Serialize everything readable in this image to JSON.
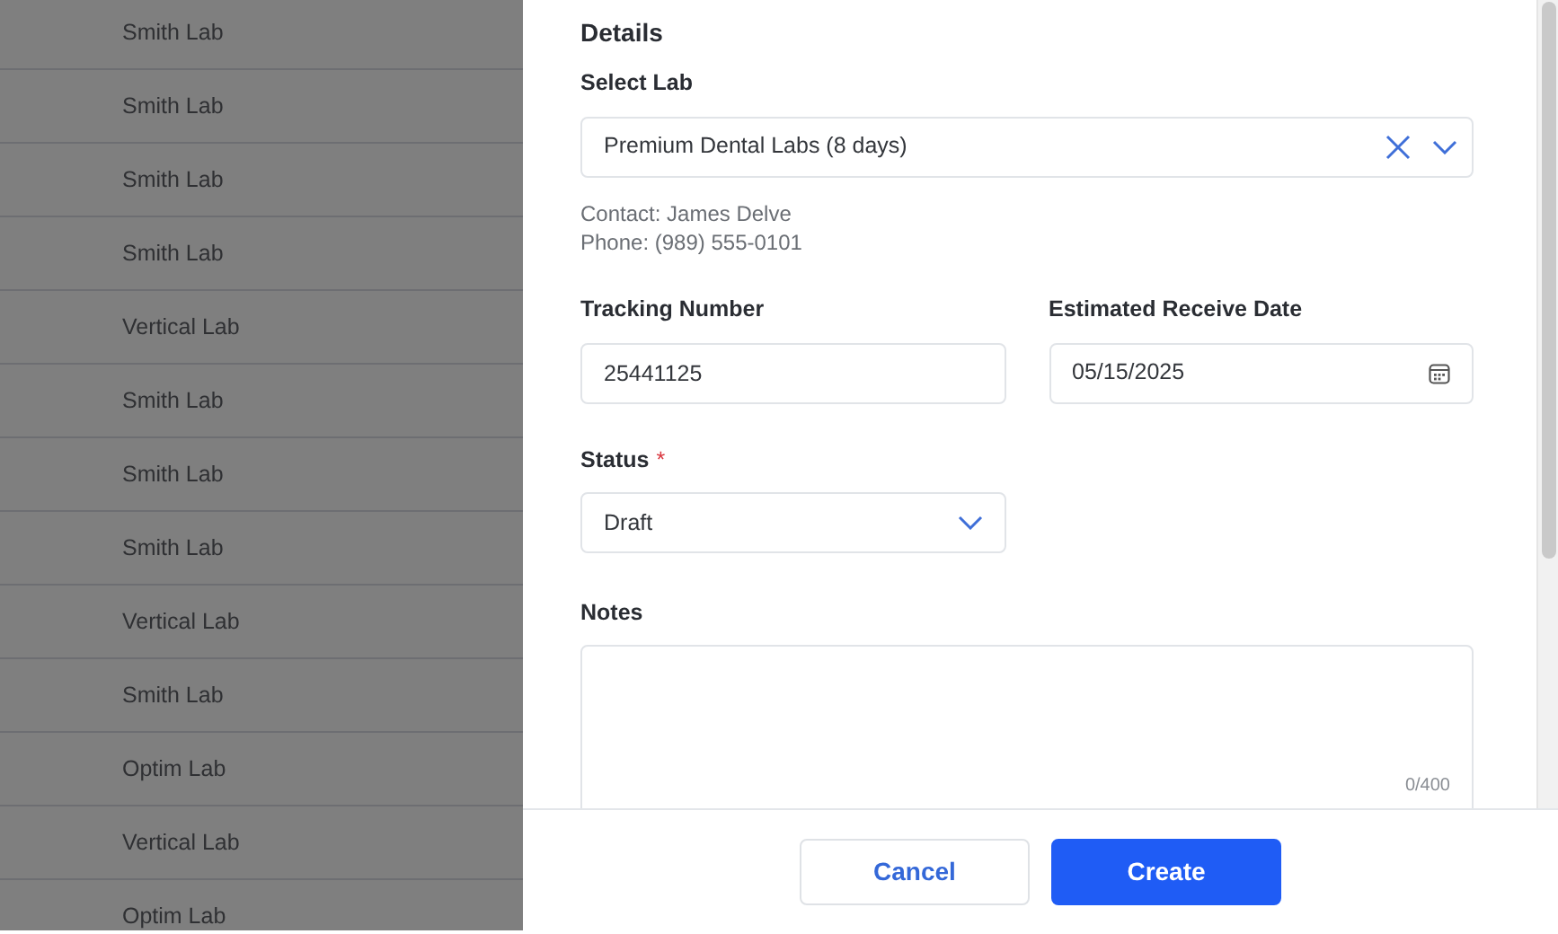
{
  "background_table": {
    "rows": [
      {
        "lab": "Smith Lab"
      },
      {
        "lab": "Smith Lab"
      },
      {
        "lab": "Smith Lab"
      },
      {
        "lab": "Smith Lab"
      },
      {
        "lab": "Vertical Lab"
      },
      {
        "lab": "Smith Lab"
      },
      {
        "lab": "Smith Lab"
      },
      {
        "lab": "Smith Lab"
      },
      {
        "lab": "Vertical Lab"
      },
      {
        "lab": "Smith Lab"
      },
      {
        "lab": "Optim Lab"
      },
      {
        "lab": "Vertical Lab"
      },
      {
        "lab": "Optim Lab"
      }
    ]
  },
  "panel": {
    "section_title": "Details",
    "select_lab": {
      "label": "Select Lab",
      "value": "Premium Dental Labs (8 days)"
    },
    "contact": "Contact: James Delve",
    "phone": "Phone: (989) 555-0101",
    "tracking_number": {
      "label": "Tracking Number",
      "value": "25441125"
    },
    "estimated_receive_date": {
      "label": "Estimated Receive Date",
      "value": "05/15/2025"
    },
    "status": {
      "label": "Status",
      "required_mark": "*",
      "value": "Draft"
    },
    "notes": {
      "label": "Notes",
      "counter": "0/400"
    },
    "buttons": [
      {
        "label": "Cancel",
        "kind": "secondary"
      },
      {
        "label": "Create",
        "kind": "primary"
      }
    ]
  }
}
